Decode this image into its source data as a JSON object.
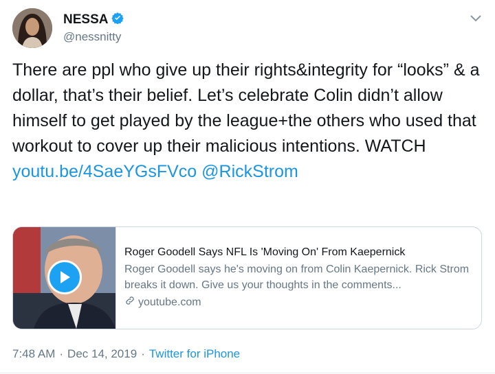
{
  "author": {
    "name": "NESSA",
    "handle": "@nessnitty",
    "verified": true
  },
  "tweet": {
    "text": "There are ppl who give up their rights&integrity for “looks” & a dollar, that’s their belief. Let’s celebrate Colin didn’t allow himself to get played by the league+the others who used that workout to cover up their malicious intentions. WATCH",
    "link": "youtu.be/4SaeYGsFVco",
    "mention": "@RickStrom"
  },
  "card": {
    "title": "Roger Goodell Says NFL Is 'Moving On' From Kaepernick",
    "description": "Roger Goodell says he's moving on from Colin Kaepernick. Rick Strom breaks it down. Give us your thoughts in the comments...",
    "domain": "youtube.com"
  },
  "meta": {
    "time": "7:48 AM",
    "separator": "·",
    "date": "Dec 14, 2019",
    "source": "Twitter for iPhone"
  },
  "icons": {
    "verified": "verified-badge-icon",
    "caret": "chevron-down-icon",
    "play": "play-icon",
    "link": "link-icon"
  },
  "colors": {
    "link": "#1b95e0",
    "verified": "#1da1f2",
    "secondary_text": "#657786",
    "border": "#ccd6dd"
  }
}
